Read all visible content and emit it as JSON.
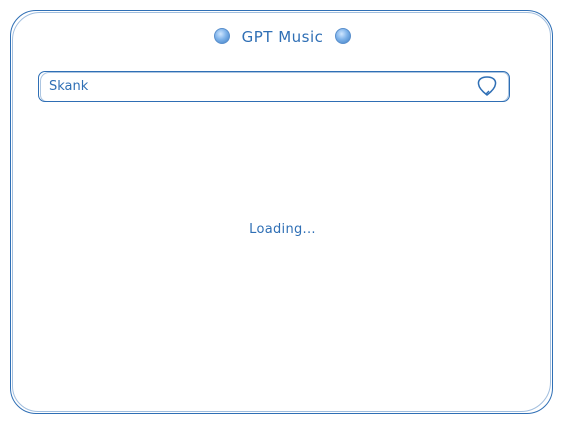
{
  "header": {
    "title": "GPT Music",
    "left_icon": "globe-icon",
    "right_icon": "globe-icon"
  },
  "search": {
    "value": "Skank",
    "button_icon": "guitar-pick-icon"
  },
  "status": {
    "text": "Loading..."
  },
  "colors": {
    "accent": "#2f6fb5",
    "background": "#ffffff"
  }
}
